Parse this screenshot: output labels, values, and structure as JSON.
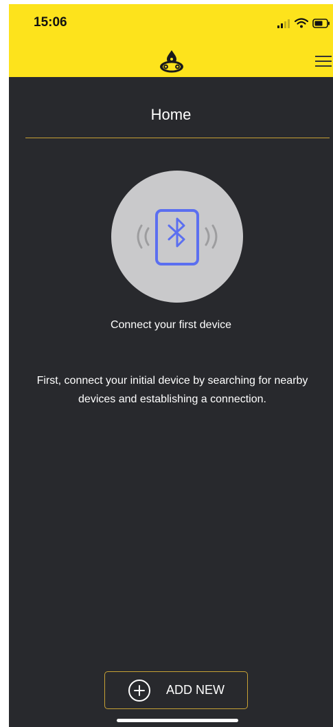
{
  "status_bar": {
    "time": "15:06",
    "icons": [
      "cellular-signal-icon",
      "wifi-icon",
      "battery-icon"
    ]
  },
  "header": {
    "logo_icon": "bike-chain-drop-logo",
    "menu_icon": "hamburger-menu-icon",
    "background_color": "#fde31c"
  },
  "page": {
    "title": "Home",
    "divider_color": "#c8a235",
    "background_color": "#28292d"
  },
  "empty_state": {
    "icon": "bluetooth-device-icon",
    "icon_color": "#5b6ff0",
    "headline": "Connect your first device",
    "description": "First, connect your initial device by searching for nearby devices and establishing a connection."
  },
  "add_button": {
    "icon": "plus-circle-icon",
    "label": "ADD NEW",
    "border_color": "#c8a235"
  }
}
